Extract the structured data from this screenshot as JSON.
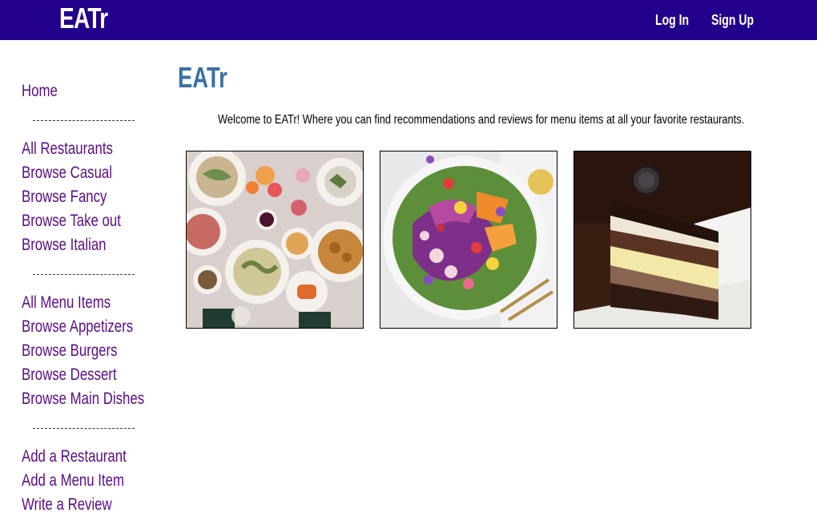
{
  "navbar": {
    "brand": "EATr",
    "login_label": "Log In",
    "signup_label": "Sign Up",
    "background": "#22008b"
  },
  "sidebar": {
    "link_color": "#5a0d88",
    "home": "Home",
    "restaurants": [
      "All Restaurants",
      "Browse Casual",
      "Browse Fancy",
      "Browse Take out",
      "Browse Italian"
    ],
    "menu_items": [
      "All Menu Items",
      "Browse Appetizers",
      "Browse Burgers",
      "Browse Dessert",
      "Browse Main Dishes"
    ],
    "actions": [
      "Add a Restaurant",
      "Add a Menu Item",
      "Write a Review"
    ]
  },
  "main": {
    "title": "EATr",
    "title_color": "#3a6fa6",
    "welcome": "Welcome to EATr! Where you can find recommendations and reviews for menu items at all your favorite restaurants.",
    "images": [
      {
        "subject": "table-of-dishes-photo"
      },
      {
        "subject": "salad-bowl-photo"
      },
      {
        "subject": "layered-cake-slice-photo"
      }
    ]
  }
}
